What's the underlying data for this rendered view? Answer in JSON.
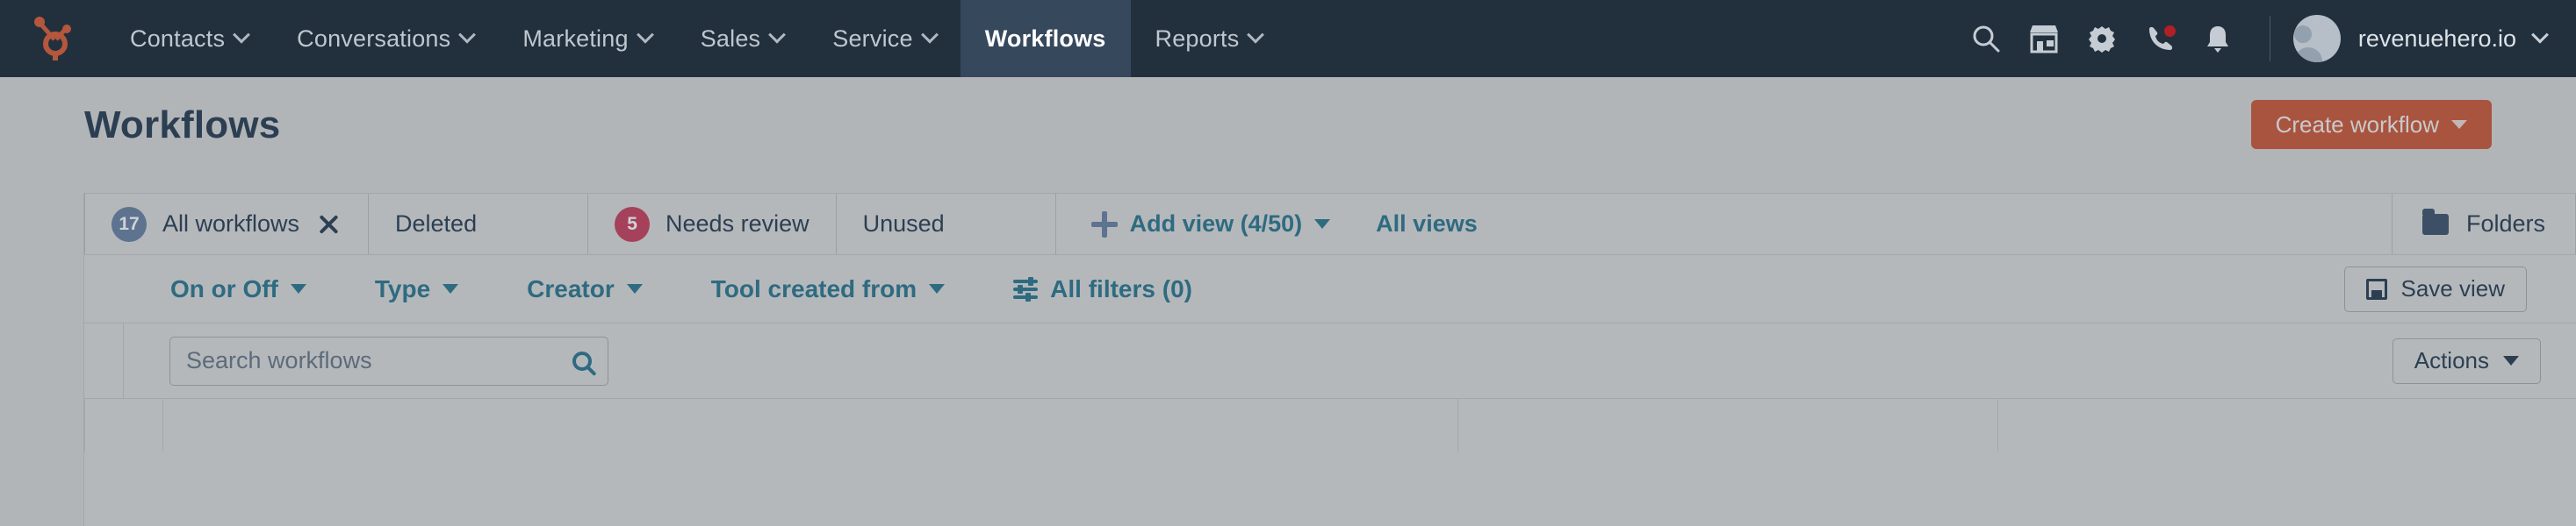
{
  "topnav": {
    "logo_icon": "hubspot-sprocket-logo",
    "items": [
      {
        "label": "Contacts",
        "has_dropdown": true,
        "active": false
      },
      {
        "label": "Conversations",
        "has_dropdown": true,
        "active": false
      },
      {
        "label": "Marketing",
        "has_dropdown": true,
        "active": false
      },
      {
        "label": "Sales",
        "has_dropdown": true,
        "active": false
      },
      {
        "label": "Service",
        "has_dropdown": true,
        "active": false
      },
      {
        "label": "Workflows",
        "has_dropdown": false,
        "active": true
      },
      {
        "label": "Reports",
        "has_dropdown": true,
        "active": false
      }
    ],
    "icons": [
      {
        "name": "search-icon"
      },
      {
        "name": "marketplace-icon"
      },
      {
        "name": "settings-gear-icon"
      },
      {
        "name": "phone-icon",
        "badge": true
      },
      {
        "name": "notifications-bell-icon"
      }
    ],
    "account_name": "revenuehero.io",
    "avatar_icon": "user-avatar"
  },
  "page": {
    "title": "Workflows",
    "create_button": "Create workflow",
    "accent_orange": "#a9543f",
    "accent_teal": "#2e6b80",
    "nav_background": "#22303e"
  },
  "views": {
    "tabs": [
      {
        "label": "All workflows",
        "count": "17",
        "count_color": "blue",
        "closable": true,
        "active": true
      },
      {
        "label": "Deleted",
        "count": "",
        "count_color": "",
        "closable": false,
        "active": false
      },
      {
        "label": "Needs review",
        "count": "5",
        "count_color": "red",
        "closable": false,
        "active": false
      },
      {
        "label": "Unused",
        "count": "",
        "count_color": "",
        "closable": false,
        "active": false
      }
    ],
    "add_view_label": "Add view (4/50)",
    "all_views_label": "All views",
    "folders_label": "Folders"
  },
  "filters": {
    "items": [
      {
        "label": "On or Off",
        "has_dropdown": true
      },
      {
        "label": "Type",
        "has_dropdown": true
      },
      {
        "label": "Creator",
        "has_dropdown": true
      },
      {
        "label": "Tool created from",
        "has_dropdown": true
      }
    ],
    "all_filters_label": "All filters (0)",
    "save_view_label": "Save view"
  },
  "search": {
    "placeholder": "Search workflows",
    "value": "",
    "actions_label": "Actions"
  }
}
